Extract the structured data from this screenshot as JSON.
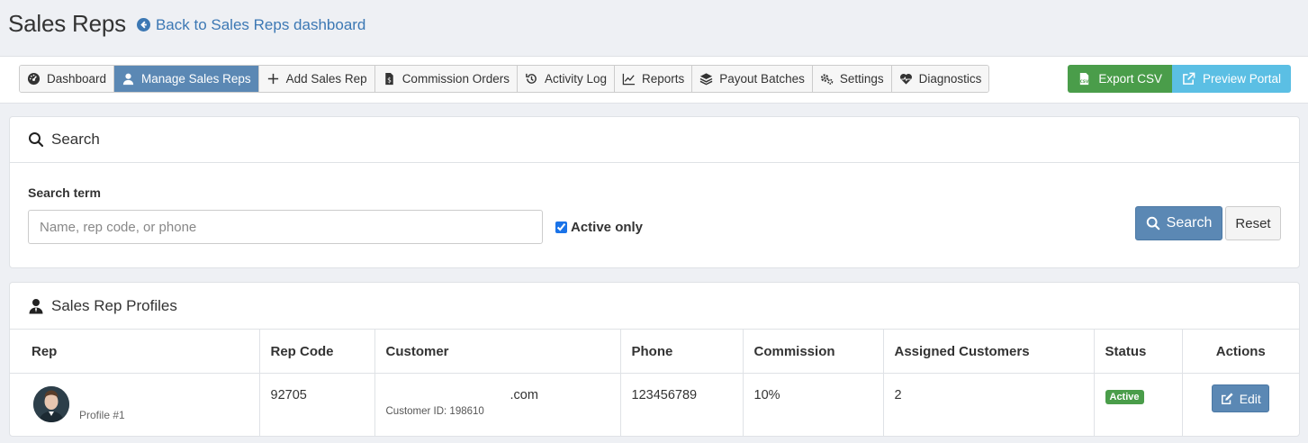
{
  "page": {
    "title": "Sales Reps",
    "back_link": "Back to Sales Reps dashboard"
  },
  "nav": {
    "items": [
      {
        "label": "Dashboard",
        "icon": "dashboard-gauge-icon",
        "active": false
      },
      {
        "label": "Manage Sales Reps",
        "icon": "user-icon",
        "active": true
      },
      {
        "label": "Add Sales Rep",
        "icon": "plus-icon",
        "active": false
      },
      {
        "label": "Commission Orders",
        "icon": "file-dollar-icon",
        "active": false
      },
      {
        "label": "Activity Log",
        "icon": "history-icon",
        "active": false
      },
      {
        "label": "Reports",
        "icon": "line-chart-icon",
        "active": false
      },
      {
        "label": "Payout Batches",
        "icon": "layers-icon",
        "active": false
      },
      {
        "label": "Settings",
        "icon": "gears-icon",
        "active": false
      },
      {
        "label": "Diagnostics",
        "icon": "heartbeat-icon",
        "active": false
      }
    ],
    "export_csv": "Export CSV",
    "preview_portal": "Preview Portal"
  },
  "search": {
    "heading": "Search",
    "term_label": "Search term",
    "placeholder": "Name, rep code, or phone",
    "value": "",
    "active_only_label": "Active only",
    "active_only_checked": true,
    "search_button": "Search",
    "reset_button": "Reset"
  },
  "profiles": {
    "heading": "Sales Rep Profiles",
    "columns": [
      "Rep",
      "Rep Code",
      "Customer",
      "Phone",
      "Commission",
      "Assigned Customers",
      "Status",
      "Actions"
    ],
    "rows": [
      {
        "profile": "Profile #1",
        "rep_code": "92705",
        "customer": ".com",
        "customer_id": "Customer ID: 198610",
        "phone": "123456789",
        "commission": "10%",
        "assigned": "2",
        "status": "Active",
        "action": "Edit"
      }
    ]
  },
  "colors": {
    "primary": "#5b88b4",
    "success": "#4a9d4a",
    "info": "#5bbfe4",
    "link": "#3c78b4"
  }
}
